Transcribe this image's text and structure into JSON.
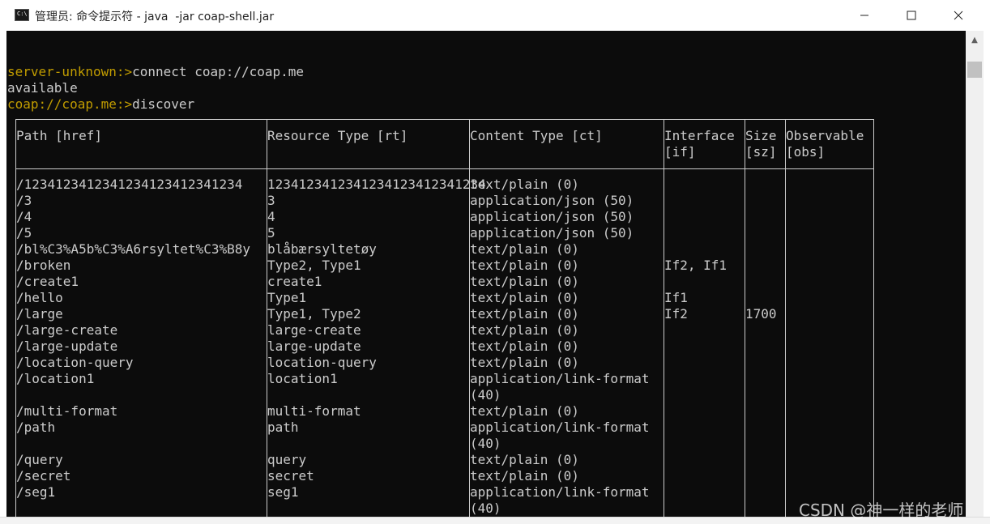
{
  "window": {
    "title": "管理员: 命令提示符 - java  -jar coap-shell.jar",
    "icon": "cmd-icon",
    "minimize_icon": "minimize-icon",
    "maximize_icon": "maximize-icon",
    "close_icon": "close-icon"
  },
  "console": {
    "lines": [
      {
        "prompt": "server-unknown:>",
        "text": "connect coap://coap.me"
      },
      {
        "prompt": "",
        "text": "available"
      },
      {
        "prompt": "coap://coap.me:>",
        "text": "discover"
      }
    ],
    "table": {
      "headers": [
        [
          "Path [href]"
        ],
        [
          "Resource Type [rt]"
        ],
        [
          "Content Type [ct]"
        ],
        [
          "Interface",
          "[if]"
        ],
        [
          "Size",
          "[sz]"
        ],
        [
          "Observable",
          "[obs]"
        ]
      ],
      "rows": [
        [
          "/1234123412341234123412341234",
          "1234123412341234123412341234",
          "text/plain (0)",
          "",
          "",
          ""
        ],
        [
          "/3",
          "3",
          "application/json (50)",
          "",
          "",
          ""
        ],
        [
          "/4",
          "4",
          "application/json (50)",
          "",
          "",
          ""
        ],
        [
          "/5",
          "5",
          "application/json (50)",
          "",
          "",
          ""
        ],
        [
          "/bl%C3%A5b%C3%A6rsyltet%C3%B8y",
          "blåbærsyltetøy",
          "text/plain (0)",
          "",
          "",
          ""
        ],
        [
          "/broken",
          "Type2, Type1",
          "text/plain (0)",
          "If2, If1",
          "",
          ""
        ],
        [
          "/create1",
          "create1",
          "text/plain (0)",
          "",
          "",
          ""
        ],
        [
          "/hello",
          "Type1",
          "text/plain (0)",
          "If1",
          "",
          ""
        ],
        [
          "/large",
          "Type1, Type2",
          "text/plain (0)",
          "If2",
          "1700",
          ""
        ],
        [
          "/large-create",
          "large-create",
          "text/plain (0)",
          "",
          "",
          ""
        ],
        [
          "/large-update",
          "large-update",
          "text/plain (0)",
          "",
          "",
          ""
        ],
        [
          "/location-query",
          "location-query",
          "text/plain (0)",
          "",
          "",
          ""
        ],
        [
          "/location1",
          "location1",
          "application/link-format|(40)",
          "",
          "",
          ""
        ],
        [
          "/multi-format",
          "multi-format",
          "text/plain (0)",
          "",
          "",
          ""
        ],
        [
          "/path",
          "path",
          "application/link-format|(40)",
          "",
          "",
          ""
        ],
        [
          "/query",
          "query",
          "text/plain (0)",
          "",
          "",
          ""
        ],
        [
          "/secret",
          "secret",
          "text/plain (0)",
          "",
          "",
          ""
        ],
        [
          "/seg1",
          "seg1",
          "application/link-format|(40)",
          "",
          "",
          ""
        ]
      ]
    }
  },
  "scrollbar": {
    "up_icon": "scroll-up-arrow-icon"
  },
  "watermark": "CSDN @神一样的老师",
  "colors": {
    "console_bg": "#0c0c0c",
    "console_text": "#cccccc",
    "prompt": "#c19c00"
  }
}
